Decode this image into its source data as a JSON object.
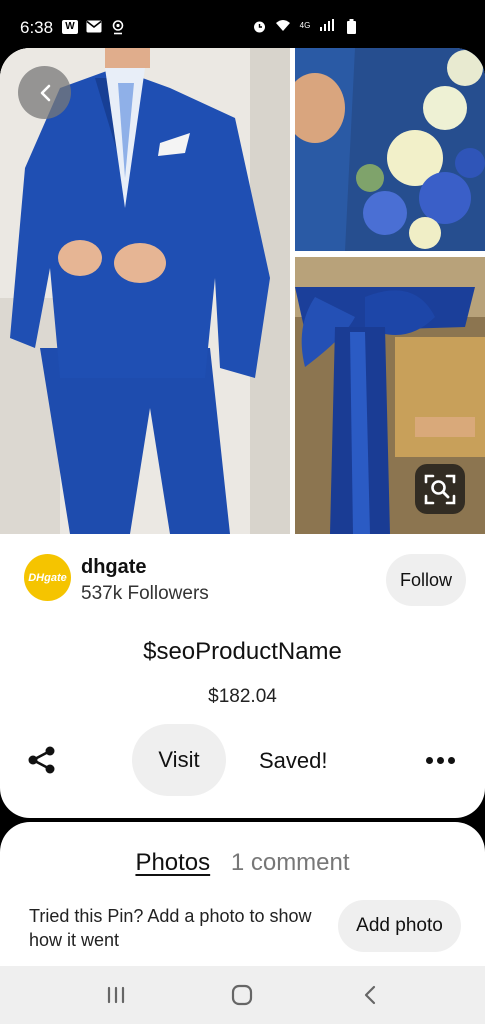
{
  "status_bar": {
    "time": "6:38",
    "left_icons": [
      "w-icon",
      "mail-icon",
      "location-icon"
    ],
    "right_icons": [
      "alarm-icon",
      "wifi-icon",
      "signal-icon",
      "battery-icon"
    ],
    "network_label": "4G"
  },
  "pin": {
    "seller": {
      "logo_text": "DHgate",
      "name": "dhgate",
      "followers": "537k Followers",
      "follow_label": "Follow"
    },
    "product_name": "$seoProductName",
    "price": "$182.04",
    "actions": {
      "visit_label": "Visit",
      "saved_label": "Saved!"
    }
  },
  "comments": {
    "tabs": [
      {
        "label": "Photos"
      },
      {
        "label": "1 comment"
      }
    ],
    "prompt": "Tried this Pin? Add a photo to show how it went",
    "add_photo_label": "Add photo"
  },
  "colors": {
    "suit_blue": "#1f4fb3",
    "logo_yellow": "#f5c400",
    "button_gray": "#efefef"
  }
}
